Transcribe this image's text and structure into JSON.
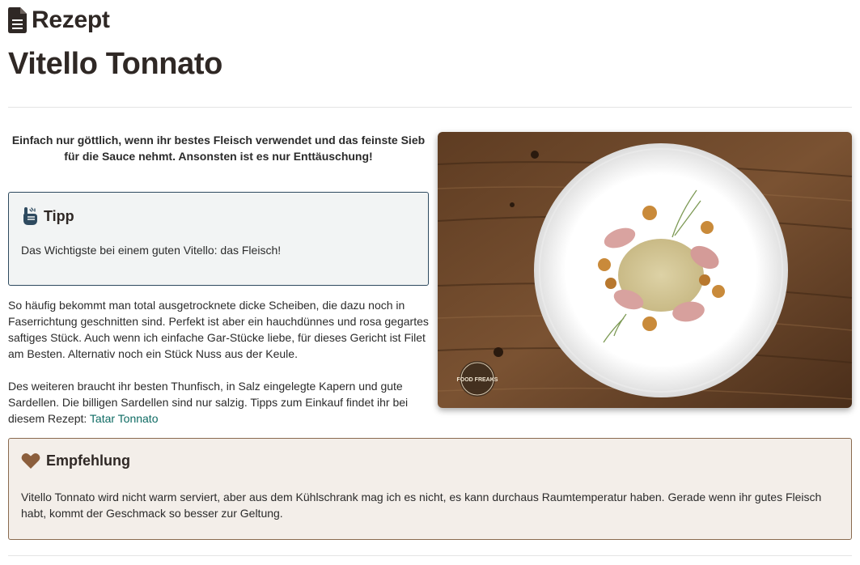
{
  "header": {
    "label": "Rezept",
    "icon": "document-icon"
  },
  "page_title": "Vitello Tonnato",
  "intro": "Einfach nur göttlich, wenn ihr bestes Fleisch verwendet und das feinste Sieb für die Sauce nehmt. Ansonsten ist es nur Enttäuschung!",
  "tip": {
    "icon": "hand-pointing-icon",
    "title": "Tipp",
    "text": "Das Wichtigste bei einem guten Vitello: das Fleisch!"
  },
  "paragraphs": {
    "p1": "So häufig bekommt man total ausgetrocknete dicke Scheiben, die dazu noch in Faserrichtung geschnitten sind. Perfekt ist aber ein hauchdünnes und rosa gegartes saftiges Stück. Auch wenn ich einfache Gar-Stücke liebe, für dieses Gericht ist Filet am Besten. Alternativ noch ein Stück Nuss aus der Keule.",
    "p2_text": "Des weiteren braucht ihr besten Thunfisch, in Salz eingelegte Kapern und gute Sardellen. Die billigen Sardellen sind nur salzig. Tipps zum Einkauf findet ihr bei diesem Rezept: ",
    "p2_link": "Tatar Tonnato"
  },
  "photo": {
    "watermark": "FOOD FREAKS"
  },
  "recommendation": {
    "icon": "heart-icon",
    "title": "Empfehlung",
    "text": "Vitello Tonnato wird nicht warm serviert, aber aus dem Kühlschrank mag ich es nicht, es kann durchaus Raumtemperatur haben. Gerade wenn ihr gutes Fleisch habt, kommt der Geschmack so besser zur Geltung."
  },
  "colors": {
    "heading": "#2f2825",
    "link": "#0e6b63",
    "tip_border": "#2e4a5f",
    "tip_bg": "#f2f4f4",
    "rec_border": "#8a6a4f",
    "rec_bg": "#f3eee9",
    "heart": "#8b5e3c"
  }
}
